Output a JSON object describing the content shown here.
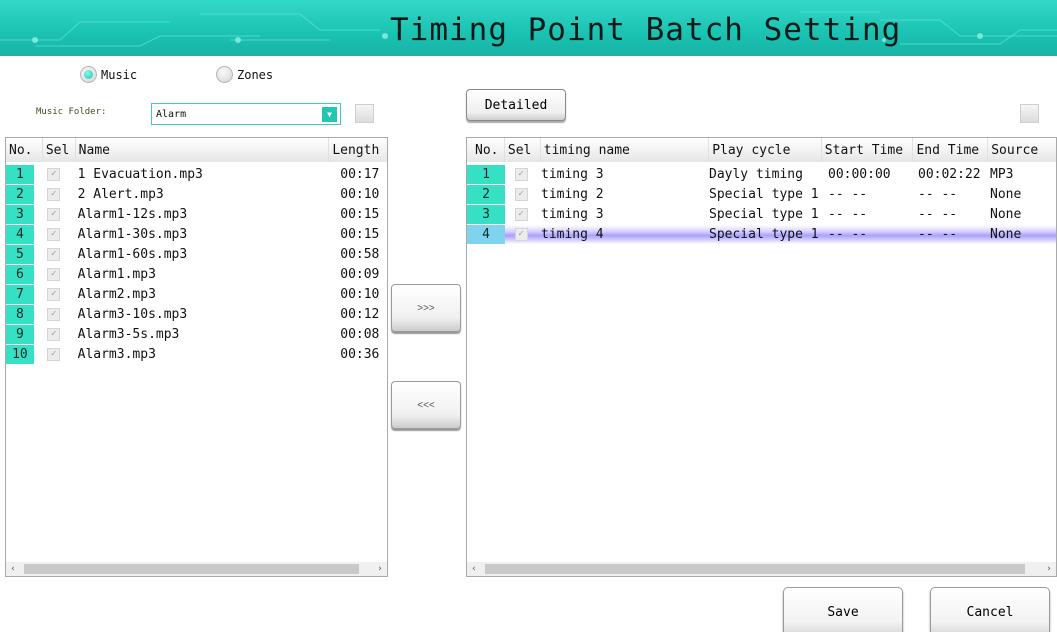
{
  "window": {
    "title": "Timing Point Batch Setting"
  },
  "mode": {
    "music_label": "Music",
    "zones_label": "Zones",
    "selected": "Music"
  },
  "music_folder": {
    "label": "Music Folder:",
    "value": "Alarm"
  },
  "detailed_label": "Detailed",
  "move_right_label": ">>>",
  "move_left_label": "<<<",
  "music_table": {
    "columns": [
      "No.",
      "Sel",
      "Name",
      "Length"
    ],
    "rows": [
      {
        "no": "1",
        "name": "1 Evacuation.mp3",
        "length": "00:17"
      },
      {
        "no": "2",
        "name": "2 Alert.mp3",
        "length": "00:10"
      },
      {
        "no": "3",
        "name": "Alarm1-12s.mp3",
        "length": "00:15"
      },
      {
        "no": "4",
        "name": "Alarm1-30s.mp3",
        "length": "00:15"
      },
      {
        "no": "5",
        "name": "Alarm1-60s.mp3",
        "length": "00:58"
      },
      {
        "no": "6",
        "name": "Alarm1.mp3",
        "length": "00:09"
      },
      {
        "no": "7",
        "name": "Alarm2.mp3",
        "length": "00:10"
      },
      {
        "no": "8",
        "name": "Alarm3-10s.mp3",
        "length": "00:12"
      },
      {
        "no": "9",
        "name": "Alarm3-5s.mp3",
        "length": "00:08"
      },
      {
        "no": "10",
        "name": "Alarm3.mp3",
        "length": "00:36"
      }
    ]
  },
  "timing_table": {
    "columns": [
      "No.",
      "Sel",
      "timing name",
      "Play cycle",
      "Start Time",
      "End Time",
      "Source"
    ],
    "rows": [
      {
        "no": "1",
        "name": "timing 3",
        "cycle": "Dayly timing",
        "start": "00:00:00",
        "end": "00:02:22",
        "source": "MP3",
        "highlighted": false
      },
      {
        "no": "2",
        "name": "timing 2",
        "cycle": "Special type 1",
        "start": "-- --",
        "end": "-- --",
        "source": "None",
        "highlighted": false
      },
      {
        "no": "3",
        "name": "timing 3",
        "cycle": "Special type 1",
        "start": "-- --",
        "end": "-- --",
        "source": "None",
        "highlighted": false
      },
      {
        "no": "4",
        "name": "timing 4",
        "cycle": "Special type 1",
        "start": "-- --",
        "end": "-- --",
        "source": "None",
        "highlighted": true
      }
    ]
  },
  "save_label": "Save",
  "cancel_label": "Cancel",
  "colors": {
    "accent": "#22c6b3",
    "row_number_bg": "#36e0c4",
    "highlight": "#a9a0ff"
  },
  "icons": {
    "dropdown": "chevron-down-icon",
    "check": "check-icon"
  }
}
